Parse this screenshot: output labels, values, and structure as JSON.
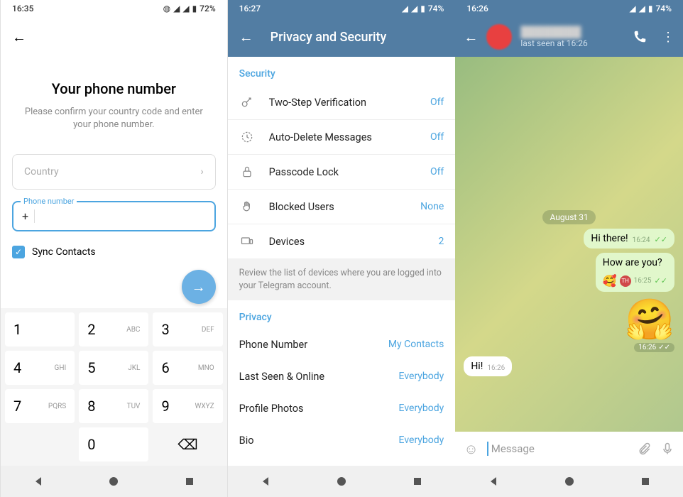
{
  "panel1": {
    "status_time": "16:35",
    "battery": "72%",
    "title": "Your phone number",
    "subtitle": "Please confirm your country code and enter your phone number.",
    "country_placeholder": "Country",
    "phone_label": "Phone number",
    "phone_prefix": "+",
    "sync_label": "Sync Contacts",
    "keys": [
      {
        "n": "1",
        "s": ""
      },
      {
        "n": "2",
        "s": "ABC"
      },
      {
        "n": "3",
        "s": "DEF"
      },
      {
        "n": "4",
        "s": "GHI"
      },
      {
        "n": "5",
        "s": "JKL"
      },
      {
        "n": "6",
        "s": "MNO"
      },
      {
        "n": "7",
        "s": "PQRS"
      },
      {
        "n": "8",
        "s": "TUV"
      },
      {
        "n": "9",
        "s": "WXYZ"
      },
      {
        "n": "",
        "s": ""
      },
      {
        "n": "0",
        "s": ""
      },
      {
        "n": "⌫",
        "s": ""
      }
    ]
  },
  "panel2": {
    "status_time": "16:27",
    "battery": "74%",
    "header_title": "Privacy and Security",
    "security_title": "Security",
    "rows": [
      {
        "label": "Two-Step Verification",
        "value": "Off"
      },
      {
        "label": "Auto-Delete Messages",
        "value": "Off"
      },
      {
        "label": "Passcode Lock",
        "value": "Off"
      },
      {
        "label": "Blocked Users",
        "value": "None"
      },
      {
        "label": "Devices",
        "value": "2"
      }
    ],
    "hint": "Review the list of devices where you are logged into your Telegram account.",
    "privacy_title": "Privacy",
    "privacy_rows": [
      {
        "label": "Phone Number",
        "value": "My Contacts"
      },
      {
        "label": "Last Seen & Online",
        "value": "Everybody"
      },
      {
        "label": "Profile Photos",
        "value": "Everybody"
      },
      {
        "label": "Bio",
        "value": "Everybody"
      }
    ]
  },
  "panel3": {
    "status_time": "16:26",
    "battery": "74%",
    "contact_status": "last seen at 16:26",
    "date_chip": "August 31",
    "msg1": "Hi there!",
    "msg1_time": "16:24",
    "msg2": "How are you?",
    "msg2_time": "16:25",
    "sticker_time": "16:26",
    "msg_in": "Hi!",
    "msg_in_time": "16:26",
    "input_placeholder": "Message"
  }
}
